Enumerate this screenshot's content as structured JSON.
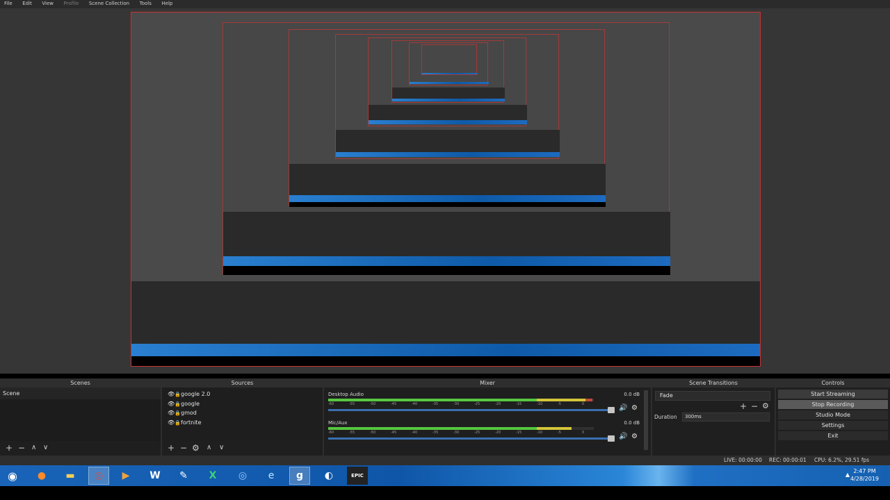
{
  "menu": [
    {
      "label": "File",
      "dim": false
    },
    {
      "label": "Edit",
      "dim": false
    },
    {
      "label": "View",
      "dim": false
    },
    {
      "label": "Profile",
      "dim": true
    },
    {
      "label": "Scene Collection",
      "dim": false
    },
    {
      "label": "Tools",
      "dim": false
    },
    {
      "label": "Help",
      "dim": false
    }
  ],
  "dock": {
    "scenes": {
      "title": "Scenes",
      "items": [
        "Scene"
      ]
    },
    "sources": {
      "title": "Sources",
      "items": [
        {
          "label": "google 2.0",
          "eye": "👁",
          "lock": "🔒"
        },
        {
          "label": "google",
          "eye": "👁",
          "lock": "🔒"
        },
        {
          "label": "gmod",
          "eye": "👁",
          "lock": "🔒"
        },
        {
          "label": "fortnite",
          "eye": "👁",
          "lock": "🔒"
        }
      ]
    },
    "mixer": {
      "title": "Mixer",
      "channels": [
        {
          "name": "Desktop Audio",
          "db": "0.0 dB",
          "level": 0.82
        },
        {
          "name": "Mic/Aux",
          "db": "0.0 dB",
          "level": 0.79
        }
      ],
      "ticks": [
        "-60",
        "-55",
        "-50",
        "-45",
        "-40",
        "-35",
        "-30",
        "-25",
        "-20",
        "-15",
        "-10",
        "-5",
        "0"
      ]
    },
    "transitions": {
      "title": "Scene Transitions",
      "selected": "Fade",
      "duration_label": "Duration",
      "duration_value": "300ms"
    },
    "controls": {
      "title": "Controls",
      "buttons": [
        {
          "label": "Start Streaming",
          "active": true
        },
        {
          "label": "Stop Recording",
          "active": true
        },
        {
          "label": "Studio Mode",
          "active": false
        },
        {
          "label": "Settings",
          "active": false
        },
        {
          "label": "Exit",
          "active": false
        }
      ]
    }
  },
  "status": {
    "live": "LIVE: 00:00:00",
    "rec": "REC: 00:00:01",
    "cpu": "CPU: 6.2%, 29.51 fps"
  },
  "taskbar": {
    "icons": [
      "start-orb-icon",
      "firefox-icon",
      "file-explorer-icon",
      "chrome-icon",
      "media-player-icon",
      "word-icon",
      "paint-icon",
      "excel-icon",
      "chrome-canary-icon",
      "internet-explorer-icon",
      "obs-icon",
      "steam-icon",
      "epic-games-icon"
    ],
    "clock_time": "2:47 PM",
    "clock_date": "4/28/2019"
  }
}
